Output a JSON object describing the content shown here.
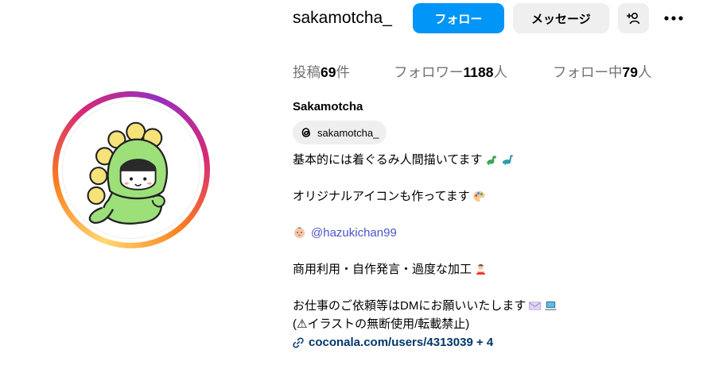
{
  "profile": {
    "username": "sakamotcha_",
    "full_name": "Sakamotcha",
    "threads_handle": "sakamotcha_"
  },
  "actions": {
    "follow_label": "フォロー",
    "message_label": "メッセージ"
  },
  "stats": {
    "posts_prefix": "投稿",
    "posts_count": "69",
    "posts_suffix": "件",
    "followers_prefix": "フォロワー",
    "followers_count": "1188",
    "followers_suffix": "人",
    "following_prefix": "フォロー中",
    "following_count": "79",
    "following_suffix": "人"
  },
  "bio": {
    "line1": "基本的には着ぐるみ人間描いてます",
    "line2": "オリジナルアイコンも作ってます",
    "mention": "@hazukichan99",
    "line4": "商用利用・自作発言・過度な加工",
    "line5": "お仕事のご依頼等はDMにお願いいたします",
    "line6": "(⚠イラストの無断使用/転載禁止)",
    "link": "coconala.com/users/4313039 + 4"
  },
  "colors": {
    "follow_button": "#0095f6",
    "secondary_button": "#efefef",
    "mention": "#4a55c8",
    "link": "#00376b"
  },
  "icons": [
    "add-user-icon",
    "more-icon",
    "threads-icon",
    "link-icon",
    "dinosaur-emoji",
    "palette-emoji",
    "baby-emoji",
    "person-emoji",
    "envelope-emoji",
    "laptop-emoji"
  ]
}
